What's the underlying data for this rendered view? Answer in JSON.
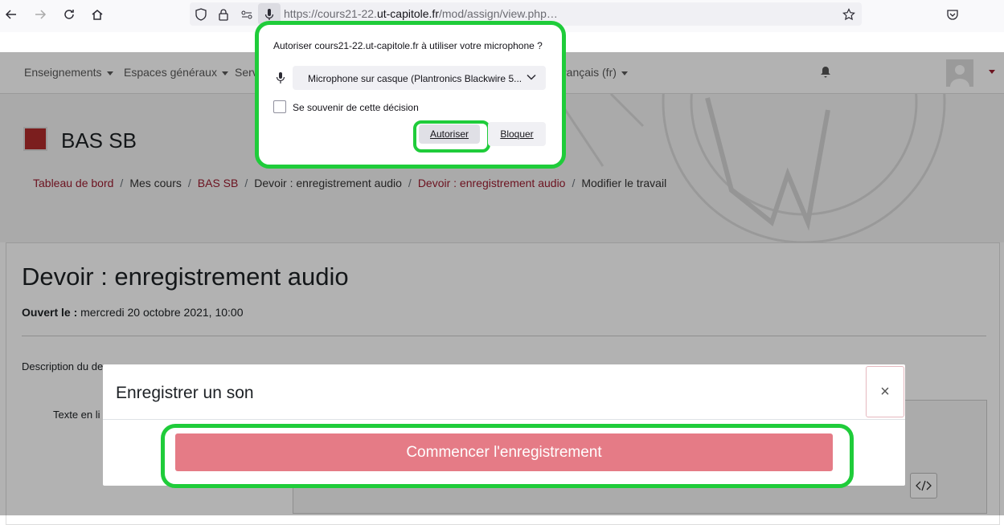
{
  "browser": {
    "url_prefix": "https://cours21-22.",
    "url_domain": "ut-capitole.fr",
    "url_path": "/mod/assign/view.php",
    "url_ellipsis": "…"
  },
  "navbar": {
    "items": [
      "Enseignements",
      "Espaces généraux",
      "Serv",
      "rançais (fr)"
    ]
  },
  "course": {
    "title": "BAS SB"
  },
  "breadcrumb": {
    "items": [
      {
        "label": "Tableau de bord",
        "link": true
      },
      {
        "label": "Mes cours",
        "link": false
      },
      {
        "label": "BAS SB",
        "link": true
      },
      {
        "label": "Devoir : enregistrement audio",
        "link": false
      },
      {
        "label": "Devoir : enregistrement audio",
        "link": true
      },
      {
        "label": "Modifier le travail",
        "link": false
      }
    ],
    "separator": "/"
  },
  "assignment": {
    "title": "Devoir : enregistrement audio",
    "opened_label": "Ouvert le :",
    "opened_value": "mercredi 20 octobre 2021, 10:00",
    "description_partial": "Description du de",
    "text_label_partial": "Texte en li"
  },
  "modal": {
    "title": "Enregistrer un son",
    "close_glyph": "×",
    "record_button": "Commencer l'enregistrement",
    "button_color": "#e57b86"
  },
  "permission_popup": {
    "question": "Autoriser cours21-22.ut-capitole.fr à utiliser votre microphone ?",
    "device": "Microphone sur casque (Plantronics Blackwire 5...",
    "remember_label": "Se souvenir de cette décision",
    "allow_button": "Autoriser",
    "block_button": "Bloquer",
    "highlight_color": "#1fcc3a"
  }
}
